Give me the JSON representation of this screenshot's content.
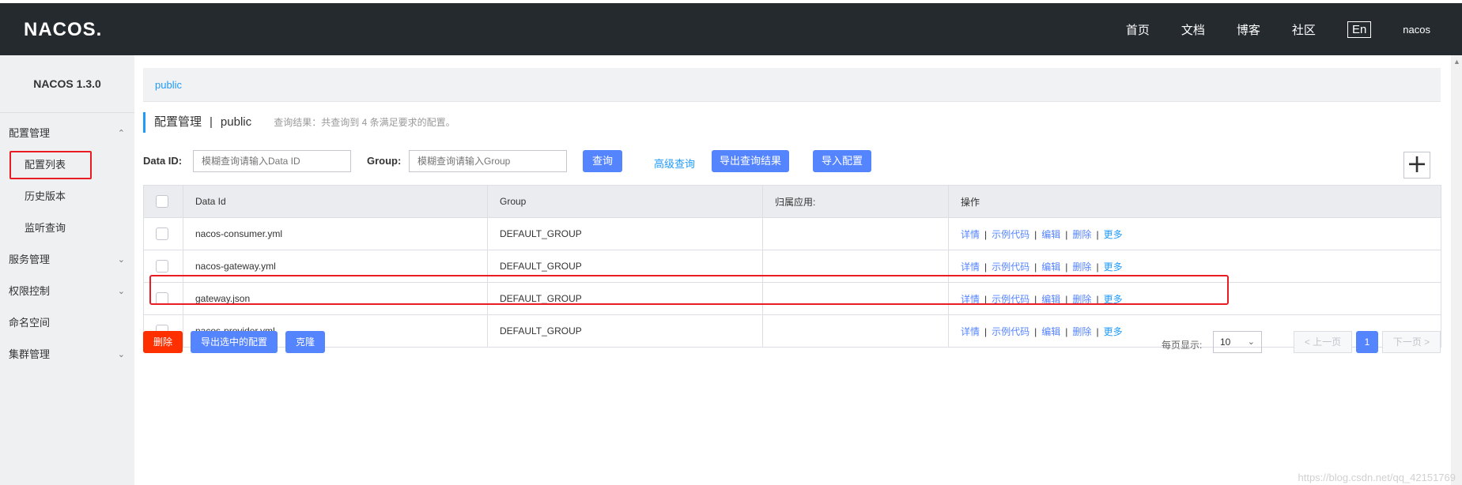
{
  "topbar": {
    "logo": "NACOS.",
    "nav": [
      "首页",
      "文档",
      "博客",
      "社区"
    ],
    "lang": "En",
    "user": "nacos"
  },
  "sidebar": {
    "version": "NACOS 1.3.0",
    "config_mgmt": "配置管理",
    "config_list": "配置列表",
    "history": "历史版本",
    "listener": "监听查询",
    "service_mgmt": "服务管理",
    "auth": "权限控制",
    "namespace": "命名空间",
    "cluster": "集群管理"
  },
  "namespace_tab": "public",
  "page": {
    "title": "配置管理",
    "separator": "|",
    "namespace": "public",
    "hint": "查询结果：共查询到 4 条满足要求的配置。"
  },
  "search": {
    "dataid_label": "Data ID:",
    "dataid_placeholder": "模糊查询请输入Data ID",
    "group_label": "Group:",
    "group_placeholder": "模糊查询请输入Group",
    "query_btn": "查询",
    "advanced": "高级查询",
    "export_result": "导出查询结果",
    "import": "导入配置"
  },
  "plus": "+",
  "table": {
    "columns": [
      "Data Id",
      "Group",
      "归属应用:",
      "操作"
    ],
    "rows": [
      {
        "data_id": "nacos-consumer.yml",
        "group": "DEFAULT_GROUP",
        "app": ""
      },
      {
        "data_id": "nacos-gateway.yml",
        "group": "DEFAULT_GROUP",
        "app": ""
      },
      {
        "data_id": "gateway.json",
        "group": "DEFAULT_GROUP",
        "app": ""
      },
      {
        "data_id": "nacos-provider.yml",
        "group": "DEFAULT_GROUP",
        "app": ""
      }
    ],
    "actions": {
      "detail": "详情",
      "sample": "示例代码",
      "edit": "编辑",
      "delete": "删除",
      "more": "更多",
      "sep": "|"
    }
  },
  "bottom": {
    "delete": "删除",
    "export_selected": "导出选中的配置",
    "clone": "克隆",
    "page_size_label": "每页显示:",
    "page_size": "10",
    "prev": "上一页",
    "current_page": "1",
    "next": "下一页"
  },
  "watermark": "https://blog.csdn.net/qq_42151769",
  "colors": {
    "primary": "#5584ff",
    "link": "#209bfa",
    "danger": "#ff3000",
    "highlight": "#e91c24",
    "header": "#252a2f"
  }
}
